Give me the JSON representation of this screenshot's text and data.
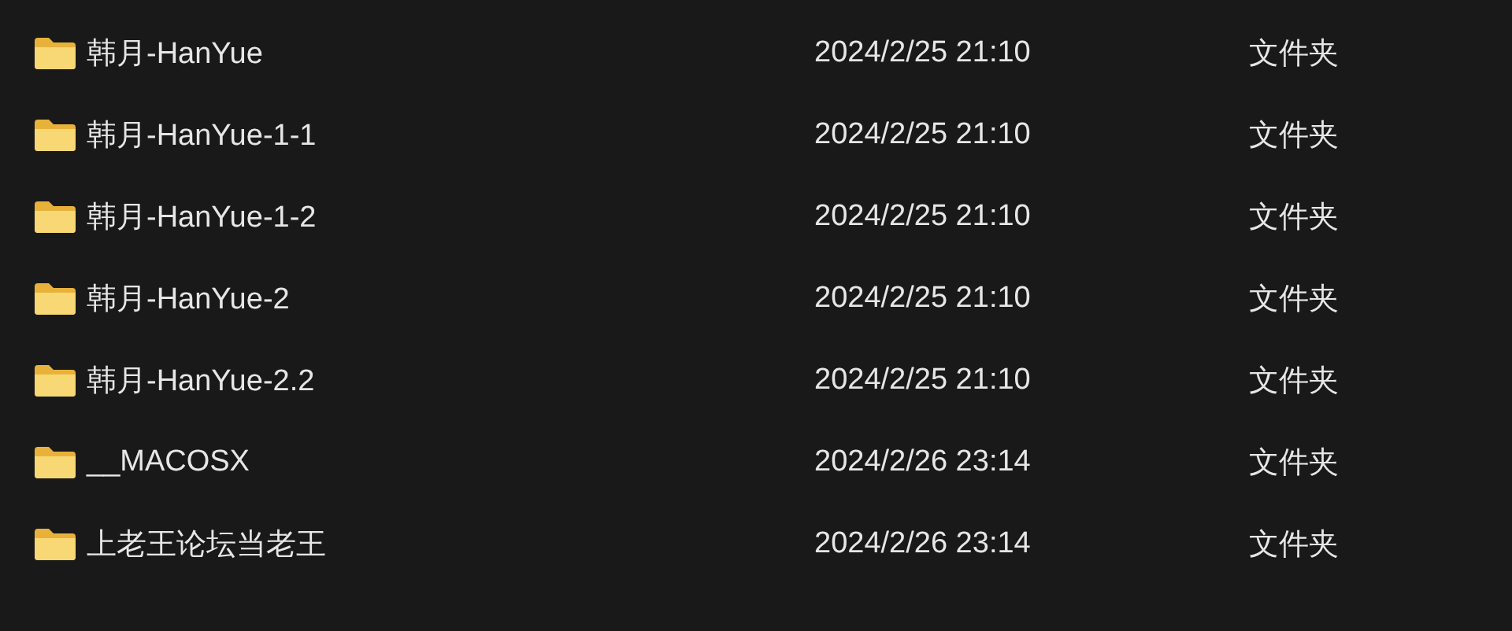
{
  "files": [
    {
      "name": "韩月-HanYue",
      "modified": "2024/2/25 21:10",
      "type": "文件夹"
    },
    {
      "name": "韩月-HanYue-1-1",
      "modified": "2024/2/25 21:10",
      "type": "文件夹"
    },
    {
      "name": "韩月-HanYue-1-2",
      "modified": "2024/2/25 21:10",
      "type": "文件夹"
    },
    {
      "name": "韩月-HanYue-2",
      "modified": "2024/2/25 21:10",
      "type": "文件夹"
    },
    {
      "name": "韩月-HanYue-2.2",
      "modified": "2024/2/25 21:10",
      "type": "文件夹"
    },
    {
      "name": "__MACOSX",
      "modified": "2024/2/26 23:14",
      "type": "文件夹"
    },
    {
      "name": "上老王论坛当老王",
      "modified": "2024/2/26 23:14",
      "type": "文件夹"
    }
  ]
}
